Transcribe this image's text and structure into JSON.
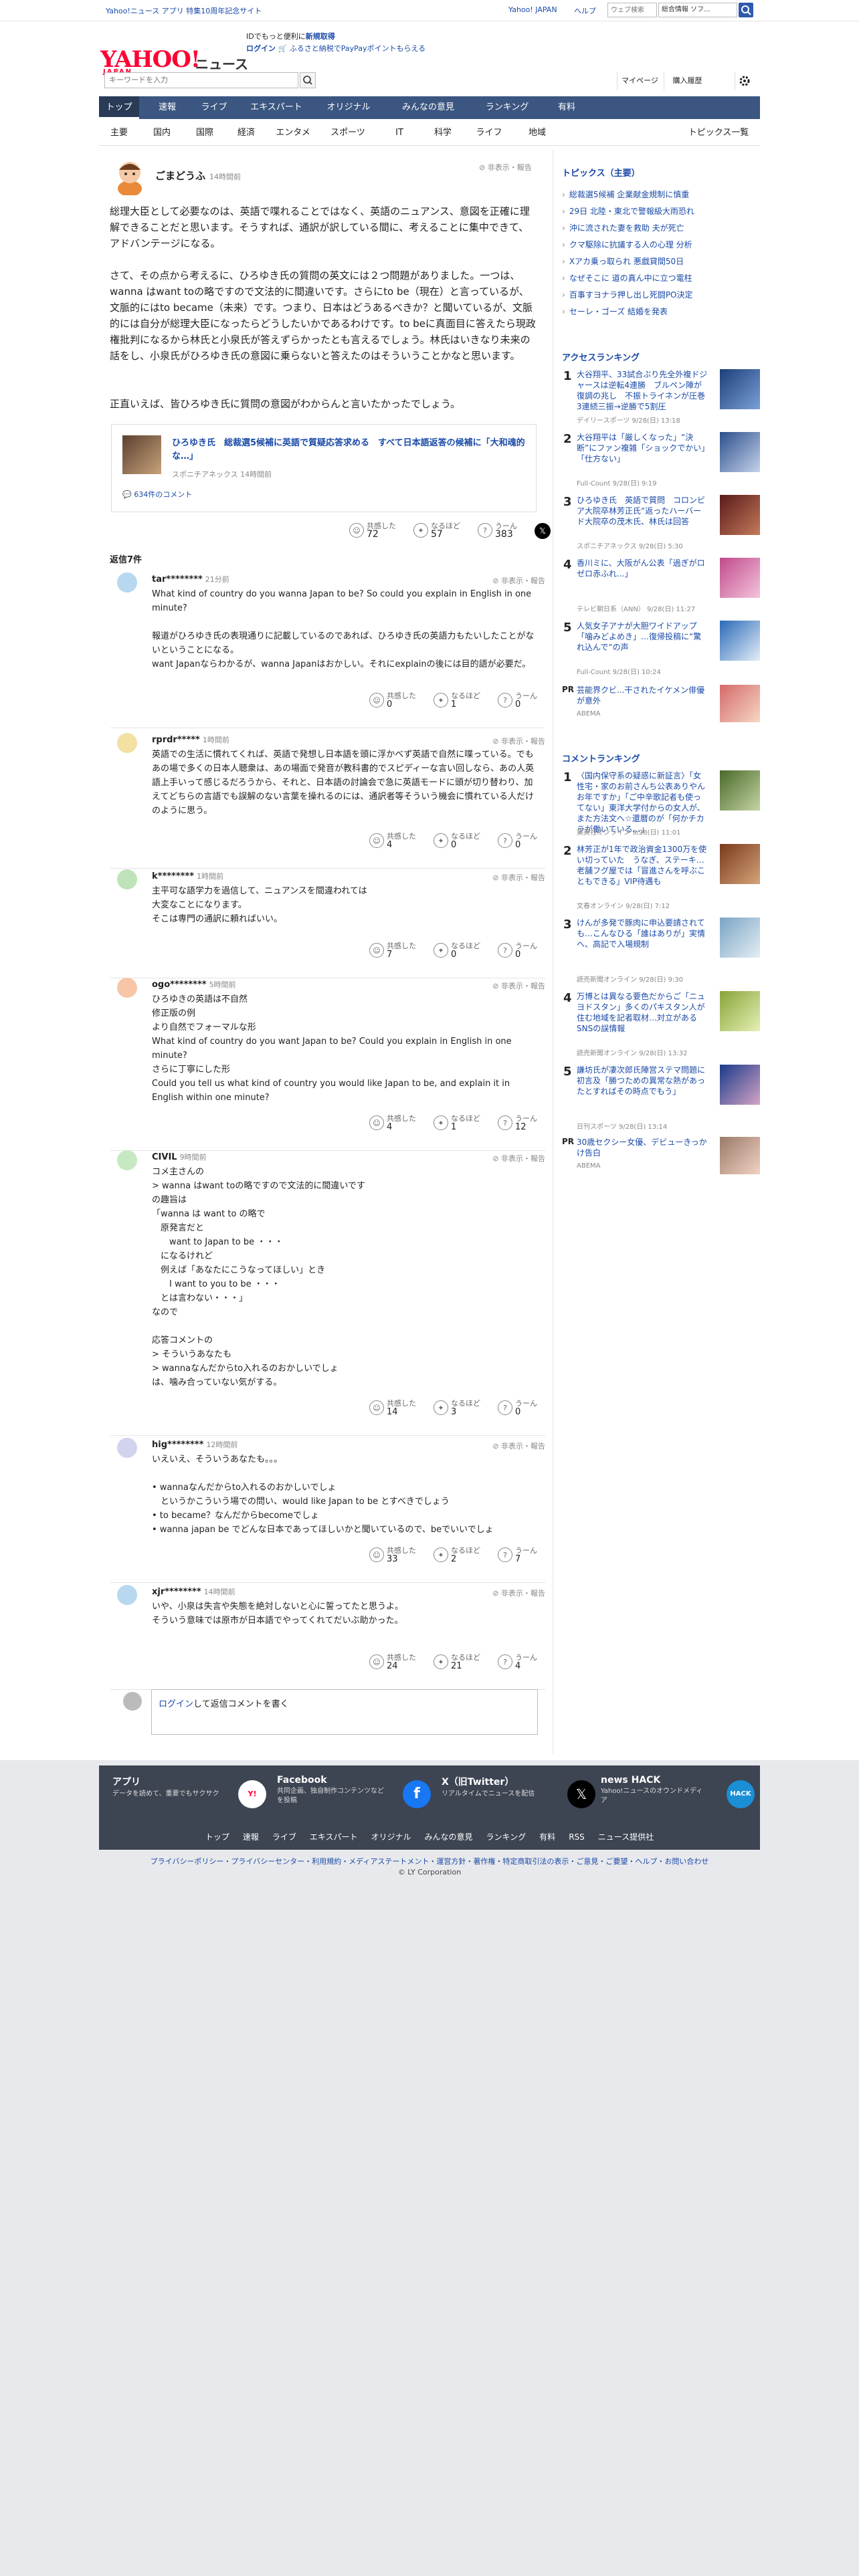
{
  "topbar": {
    "left": "Yahoo!ニュース アプリ 特集10周年記念サイト",
    "yjapan": "Yahoo! JAPAN",
    "help": "ヘルプ",
    "search_placeholder": "ウェブ検索",
    "search_btn": "総合情報 ソフ..."
  },
  "header": {
    "logo": "YAHOO!",
    "logo_sub": "JAPAN",
    "news": "ニュース",
    "promo1": "IDでもっと便利に",
    "promo_link": "新規取得",
    "login": "ログイン",
    "promo2": "ふるさと納税でPayPayポイントもらえる",
    "kw_placeholder": "キーワードを入力",
    "mypage": "マイページ",
    "history": "購入履歴"
  },
  "mainnav": [
    "トップ",
    "速報",
    "ライブ",
    "エキスパート",
    "オリジナル",
    "みんなの意見",
    "ランキング",
    "有料"
  ],
  "subnav": [
    "主要",
    "国内",
    "国際",
    "経済",
    "エンタメ",
    "スポーツ",
    "IT",
    "科学",
    "ライフ",
    "地域"
  ],
  "subnav_right": "トピックス一覧",
  "parent": {
    "name": "ごまどうふ",
    "time": "14時間前",
    "report": "非表示・報告",
    "p1": "総理大臣として必要なのは、英語で喋れることではなく、英語のニュアンス、意図を正確に理解できることだと思います。そうすれば、通訳が訳している間に、考えることに集中できて、アドバンテージになる。",
    "p2": "さて、その点から考えるに、ひろゆき氏の質問の英文には２つ問題がありました。一つは、wanna はwant toの略ですので文法的に間違いです。さらにto be（現在）と言っているが、文脈的にはto became（未来）です。つまり、日本はどうあるべきか？と聞いているが、文脈的には自分が総理大臣になったらどうしたいかであるわけです。to beに真面目に答えたら現政権批判になるから林氏と小泉氏が答えずらかったとも言えるでしょう。林氏はいきなり未来の話をし、小泉氏がひろゆき氏の意図に乗らないと答えたのはそういうことかなと思います。",
    "p3": "正直いえば、皆ひろゆき氏に質問の意図がわからんと言いたかったでしょう。",
    "article_title": "ひろゆき氏　総裁選5候補に英語で質疑応答求める　すべて日本語返答の候補に「大和魂的な…」",
    "article_src": "スポニチアネックス 14時間前",
    "article_comments": "634件のコメント",
    "r1": "共感した",
    "r1n": "72",
    "r2": "なるほど",
    "r2n": "57",
    "r3": "うーん",
    "r3n": "383"
  },
  "replies_count": "返信7件",
  "replies": [
    {
      "name": "tar********",
      "time": "21分前",
      "body": "What kind of country do you wanna Japan to be? So could you explain in English in one minute?\n\n報道がひろゆき氏の表現通りに記載しているのであれば、ひろゆき氏の英語力もたいしたことがないということになる。\nwant Japanならわかるが、wanna Japanはおかしい。それにexplainの後には目的語が必要だ。",
      "a": "0",
      "b": "1",
      "c": "0"
    },
    {
      "name": "rprdr*****",
      "time": "1時間前",
      "body": "英語での生活に慣れてくれば、英語で発想し日本語を頭に浮かべず英語で自然に喋っている。でもあの場で多くの日本人聴衆は、あの場面で発音が教科書的でスピディーな言い回しなら、あの人英語上手いって感じるだろうから、それと、日本語の討論会で急に英語モードに頭が切り替わり、加えてどちらの言語でも誤解のない言葉を操れるのには、通訳者等そういう機会に慣れている人だけのように思う。",
      "a": "4",
      "b": "0",
      "c": "0"
    },
    {
      "name": "k********",
      "time": "1時間前",
      "body": "主平可な語学力を過信して、ニュアンスを間違われては\n大変なことになります。\nそこは専門の通訳に頼ればいい。",
      "a": "7",
      "b": "0",
      "c": "0"
    },
    {
      "name": "ogo********",
      "time": "5時間前",
      "body": "ひろゆきの英語は不自然\n修正版の例\nより自然でフォーマルな形\nWhat kind of country do you want Japan to be? Could you explain in English in one minute?\nさらに丁寧にした形\nCould you tell us what kind of country you would like Japan to be, and explain it in English within one minute?",
      "a": "4",
      "b": "1",
      "c": "12"
    },
    {
      "name": "CIVIL",
      "time": "9時間前",
      "body": "コメ主さんの\n> wanna はwant toの略ですので文法的に間違いです\nの趣旨は\n「wanna は want to の略で\n　原発言だと\n　　want to Japan to be ・・・\n　になるけれど\n　例えば「あなたにこうなってほしい」とき\n　　I want to you to be ・・・\n　とは言わない・・・」\nなので\n\n応答コメントの\n> そういうあなたも\n> wannaなんだからto入れるのおかしいでしょ\nは、噛み合っていない気がする。",
      "a": "14",
      "b": "3",
      "c": "0"
    },
    {
      "name": "hig********",
      "time": "12時間前",
      "body": "いえいえ、そういうあなたも。。。\n\n• wannaなんだからto入れるのおかしいでしょ\n　というかこういう場での問い、would like Japan to be とすべきでしょう\n• to became？なんだからbecomeでしょ\n• wanna japan be でどんな日本であってほしいかと聞いているので、beでいいでしょ",
      "a": "33",
      "b": "2",
      "c": "7"
    },
    {
      "name": "xjr********",
      "time": "14時間前",
      "body": "いや、小泉は失言や失態を絶対しないと心に誓ってたと思うよ。\nそういう意味では原市が日本語でやってくれてだいぶ助かった。",
      "a": "24",
      "b": "21",
      "c": "4"
    }
  ],
  "reply_box": {
    "login": "ログイン",
    "text": "して返信コメントを書く"
  },
  "sidebar": {
    "topics_title": "トピックス（主要）",
    "topics": [
      "総裁選5候補 企業献金規制に慎重",
      "29日 北陸・東北で警報級大雨恐れ",
      "沖に流された妻を救助 夫が死亡",
      "クマ駆除に抗議する人の心理 分析",
      "Xアカ乗っ取られ 悪戯貸間50日",
      "なぜそこに 道の真ん中に立つ電柱",
      "百事すヨナラ押し出し死闘PO決定",
      "セーレ・ゴーズ 結婚を発表"
    ],
    "access_title": "アクセスランキング",
    "access": [
      {
        "n": "1",
        "t": "大谷翔平、33試合ぶり先全外複ドジャースは逆転4連勝　ブルペン陣が復調の兆し　不振トライネンが圧巻3連続三振→逆勝で5割圧",
        "s": "デイリースポーツ 9/28(日) 13:18"
      },
      {
        "n": "2",
        "t": "大谷翔平は「厳しくなった」“決断”にファン複雑「ショックでかい」「仕方ない」",
        "s": "Full-Count 9/28(日) 9:19"
      },
      {
        "n": "3",
        "t": "ひろゆき氏　英語で質問　コロンビア大院卒林芳正氏“返ったハーバード大院卒の茂木氏、林氏は回答",
        "s": "スポニチアネックス 9/28(日) 5:30"
      },
      {
        "n": "4",
        "t": "香川ミに、大阪がん公表「過ぎがロゼロ赤ふれ...」",
        "s": "テレビ朝日系（ANN） 9/28(日) 11:27"
      },
      {
        "n": "5",
        "t": "人気女子アナが大胆ワイドアップ「噛みどよめき」…復帰投稿に“驚れ込んで”の声",
        "s": "Full-Count 9/28(日) 10:24"
      }
    ],
    "pr1": "芸能界クビ...干されたイケメン俳優が意外",
    "pr1_src": "ABEMA",
    "comment_title": "コメントランキング",
    "comments": [
      {
        "n": "1",
        "t": "〈国内保守系の疑惑に新証言〉「女性宅・家のお前さんち公表ありやんお年ですか」「ご中辛歌記者も使ってない」東洋大学付からの女人が、また方法文へ☆還暦のが「何かチカラが働いている…」",
        "s": "集英社オンライン 9/28(日) 11:01"
      },
      {
        "n": "2",
        "t": "林芳正が1年で政治資金1300万を使い切っていた　うなぎ、ステーキ…老舗フグ屋では「冒進さんを呼ぶこともできる」VIP待遇も",
        "s": "文春オンライン 9/28(日) 7:12"
      },
      {
        "n": "3",
        "t": "けんが多発で豚肉に申込要請されても…こんなひる「誰はありが」実情へ、高記で入場規制",
        "s": "読売新聞オンライン 9/28(日) 9:30"
      },
      {
        "n": "4",
        "t": "万博とは異なる要色だからご「ニュヨドスタン」多くのパキスタン人が住む地域を記者取材…対立があるSNSの誤情報",
        "s": "読売新聞オンライン 9/28(日) 13:32"
      },
      {
        "n": "5",
        "t": "謙坊氏が凄次郎氏陣営ステマ問題に初言及「勝つための異常な熱があったとすればその時点でもう」",
        "s": "日刊スポーツ 9/28(日) 13:14"
      }
    ],
    "pr2": "30歳セクシー女優、デビューきっかけ告白",
    "pr2_src": "ABEMA"
  },
  "footer": {
    "app": "アプリ",
    "app_d": "データを読めて、重要でもサクサク",
    "fb": "Facebook",
    "fb_d": "共同企画、独自制作コンテンツなどを投稿",
    "x": "X（旧Twitter）",
    "x_d": "リアルタイムでニュースを配信",
    "hack": "news HACK",
    "hack_d": "Yahoo!ニュースのオウンドメディア",
    "links": [
      "トップ",
      "速報",
      "ライブ",
      "エキスパート",
      "オリジナル",
      "みんなの意見",
      "ランキング",
      "有料",
      "RSS",
      "ニュース提供社"
    ],
    "legal": "プライバシーポリシー・プライバシーセンター・利用規約・メディアステートメント・運営方針・著作権・特定商取引法の表示・ご意見・ご要望・ヘルプ・お問い合わせ",
    "copy": "© LY Corporation"
  }
}
